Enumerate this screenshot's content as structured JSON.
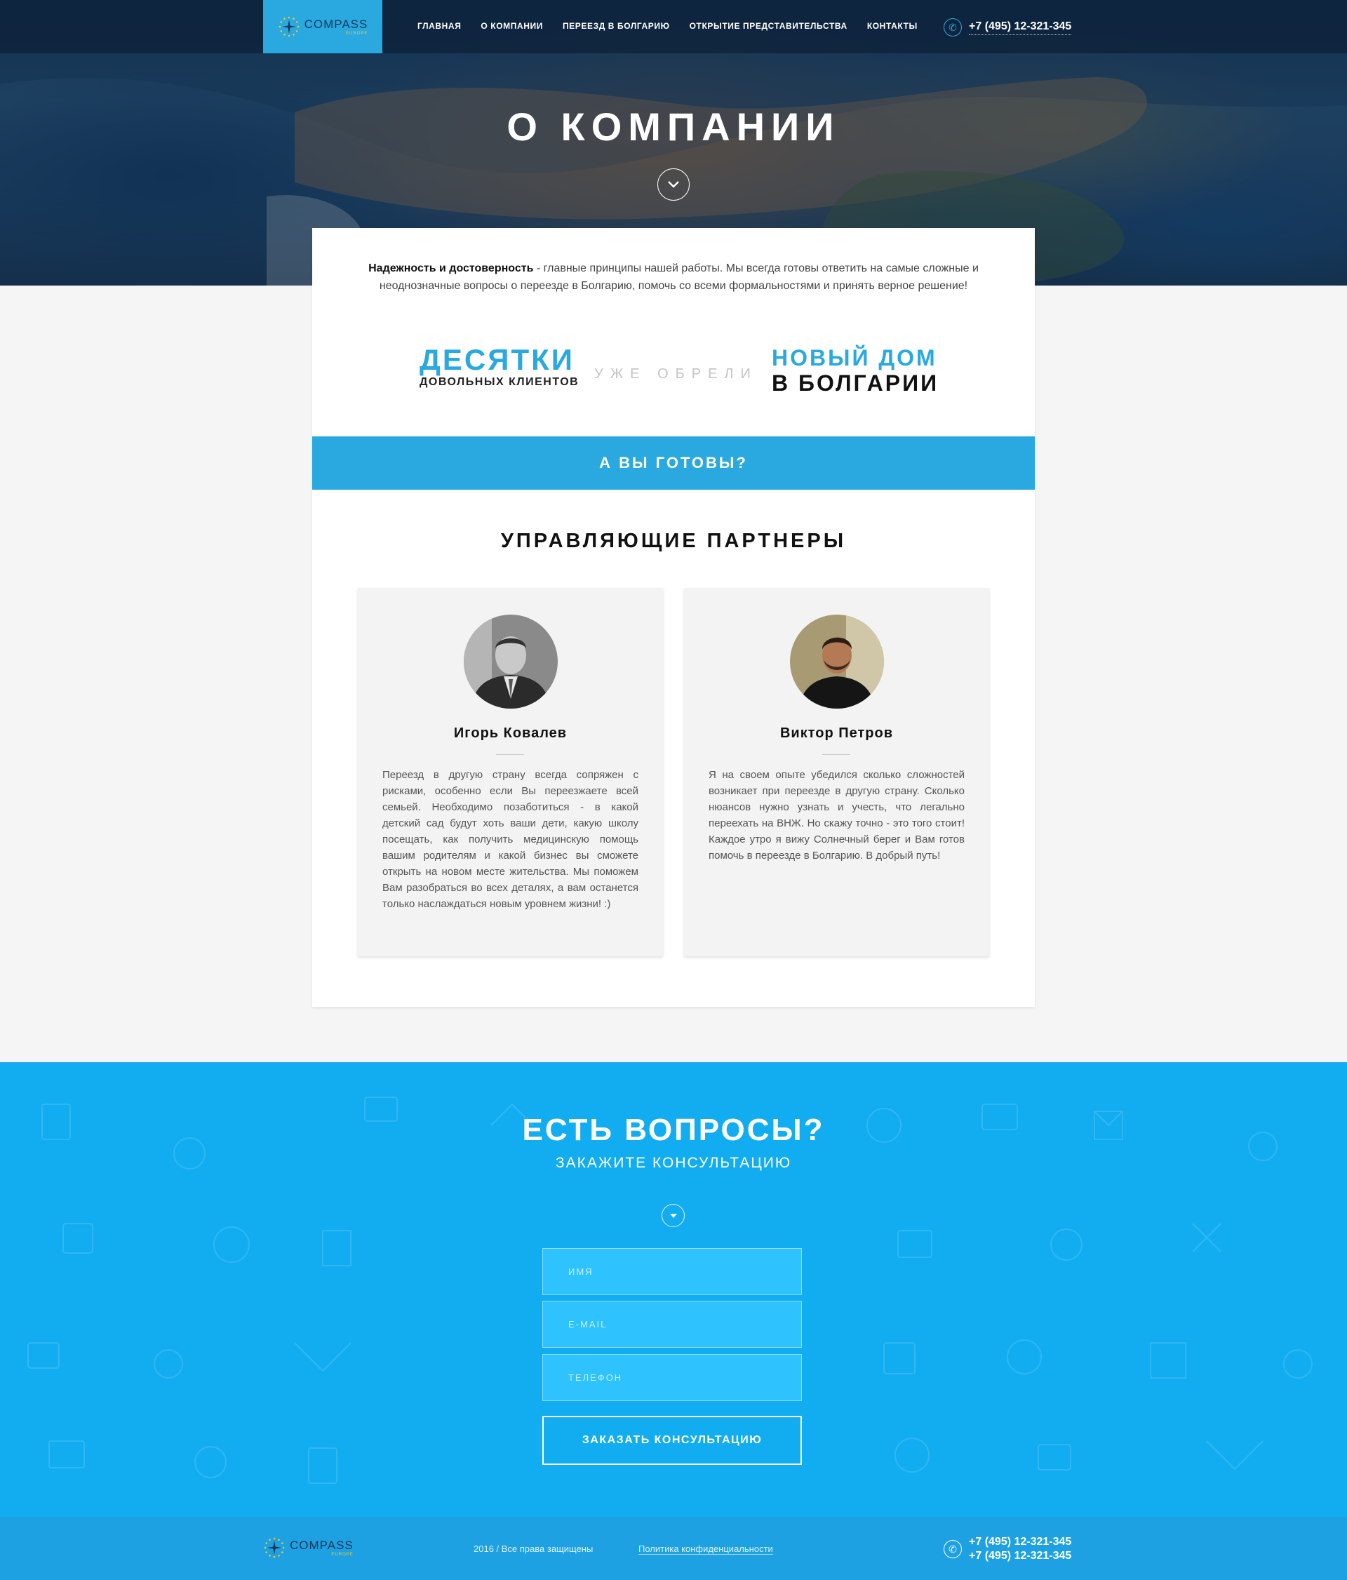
{
  "header": {
    "logo_text": "COMPASS",
    "logo_sub": "EUROPE",
    "nav": [
      {
        "label": "ГЛАВНАЯ"
      },
      {
        "label": "О КОМПАНИИ"
      },
      {
        "label": "ПЕРЕЕЗД В БОЛГАРИЮ"
      },
      {
        "label": "ОТКРЫТИЕ ПРЕДСТАВИТЕЛЬСТВА"
      },
      {
        "label": "КОНТАКТЫ"
      }
    ],
    "phone": "+7 (495) 12-321-345"
  },
  "hero": {
    "title": "О КОМПАНИИ"
  },
  "intro": {
    "bold": "Надежность и достоверность",
    "text": " - главные принципы нашей работы. Мы всегда готовы ответить на самые сложные и неоднозначные вопросы о переезде в Болгарию, помочь со всеми формальностями и принять верное решение!"
  },
  "stats": {
    "left_big": "ДЕСЯТКИ",
    "left_small": "ДОВОЛЬНЫХ КЛИЕНТОВ",
    "middle": "УЖЕ ОБРЕЛИ",
    "right_top": "НОВЫЙ ДОМ",
    "right_bottom": "В БОЛГАРИИ"
  },
  "ready_button": "А ВЫ ГОТОВЫ?",
  "partners": {
    "title": "УПРАВЛЯЮЩИЕ ПАРТНЕРЫ",
    "items": [
      {
        "name": "Игорь Ковалев",
        "text": "Переезд в другую страну всегда сопряжен с рисками, особенно если Вы переезжаете всей семьей. Необходимо позаботиться - в какой детский сад будут хоть ваши дети, какую школу посещать, как получить медицинскую помощь вашим родителям и какой бизнес вы сможете открыть на новом месте жительства. Мы поможем Вам разобраться во всех деталях, а вам останется только наслаждаться новым уровнем жизни! :)"
      },
      {
        "name": "Виктор Петров",
        "text": "Я на своем опыте убедился сколько сложностей возникает при переезде в другую страну. Сколько нюансов нужно узнать и учесть, что легально переехать на ВНЖ. Но скажу точно - это того стоит! Каждое утро я вижу Солнечный берег и Вам готов помочь в переезде в Болгарию. В добрый путь!"
      }
    ]
  },
  "contact": {
    "title": "ЕСТЬ ВОПРОСЫ?",
    "subtitle": "ЗАКАЖИТЕ КОНСУЛЬТАЦИЮ",
    "fields": {
      "name": "ИМЯ",
      "email": "E-MAIL",
      "phone": "ТЕЛЕФОН"
    },
    "submit": "ЗАКАЗАТЬ КОНСУЛЬТАЦИЮ"
  },
  "footer": {
    "logo_text": "COMPASS",
    "logo_sub": "EUROPE",
    "copyright": "2016 / Все права защищены",
    "policy": "Политика конфиденциальности",
    "phones": [
      "+7 (495) 12-321-345",
      "+7 (495) 12-321-345"
    ]
  },
  "colors": {
    "accent": "#29a9e0",
    "contact_bg": "#12adf0",
    "footer_bg": "#1ea1e2",
    "logo_sub": "#f6c62a"
  }
}
